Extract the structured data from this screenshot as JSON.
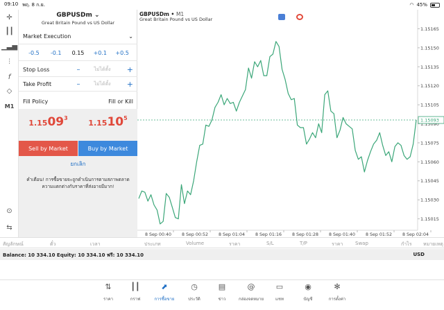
{
  "status": {
    "time": "09:10",
    "date": "พฤ. 8 ก.ย.",
    "battery": "45%"
  },
  "toolrail": {
    "indicator_label": "M1"
  },
  "panel": {
    "symbol": "GBPUSDm",
    "symbol_desc": "Great Britain Pound vs US Dollar",
    "execution": "Market Execution",
    "volume": {
      "minus05": "-0.5",
      "minus01": "-0.1",
      "value": "0.15",
      "plus01": "+0.1",
      "plus05": "+0.5"
    },
    "stop_loss": {
      "label": "Stop Loss",
      "placeholder": "ไม่ได้ตั้ง"
    },
    "take_profit": {
      "label": "Take Profit",
      "placeholder": "ไม่ได้ตั้ง"
    },
    "fill_policy": {
      "label": "Fill Policy",
      "value": "Fill or Kill"
    },
    "bid": {
      "prefix": "1.15",
      "big": "09",
      "sup": "3"
    },
    "ask": {
      "prefix": "1.15",
      "big": "10",
      "sup": "5"
    },
    "sell_label": "Sell by Market",
    "buy_label": "Buy by Market",
    "cancel_label": "ยกเลิก",
    "warning": "คำเตือน! การซื้อขายจะถูกดำเนินการตามสภาพตลาด ความแตกต่างกับราคาที่ส่งอาจมีมาก!"
  },
  "chart": {
    "symbol": "GBPUSDm",
    "timeframe": "M1",
    "subtitle": "Great Britain Pound vs US Dollar",
    "current_price_label": "1.15093",
    "line_color": "#3aa678"
  },
  "chart_data": {
    "type": "line",
    "x_ticks": [
      "8 Sep 00:40",
      "8 Sep 00:52",
      "8 Sep 01:04",
      "8 Sep 01:16",
      "8 Sep 01:28",
      "8 Sep 01:40",
      "8 Sep 01:52",
      "8 Sep 02:04"
    ],
    "y_ticks": [
      "1.15165",
      "1.15150",
      "1.15135",
      "1.15120",
      "1.15105",
      "1.15090",
      "1.15075",
      "1.15060",
      "1.15045",
      "1.15030",
      "1.15015"
    ],
    "ylim": [
      1.15006,
      1.15168
    ],
    "current_price": 1.15093,
    "values": [
      1.15031,
      1.15037,
      1.15036,
      1.15029,
      1.15034,
      1.15026,
      1.15022,
      1.15011,
      1.15013,
      1.15035,
      1.15032,
      1.15024,
      1.15016,
      1.15015,
      1.15042,
      1.15027,
      1.15037,
      1.15034,
      1.15045,
      1.1506,
      1.15073,
      1.15074,
      1.15089,
      1.15088,
      1.15093,
      1.15103,
      1.15107,
      1.15113,
      1.15105,
      1.1511,
      1.15106,
      1.15107,
      1.151,
      1.15107,
      1.15112,
      1.15117,
      1.15134,
      1.15126,
      1.15139,
      1.15135,
      1.1514,
      1.15128,
      1.15128,
      1.15143,
      1.15145,
      1.15155,
      1.15151,
      1.15133,
      1.15125,
      1.15114,
      1.15109,
      1.1511,
      1.15089,
      1.15087,
      1.15087,
      1.15074,
      1.15078,
      1.15083,
      1.15079,
      1.1509,
      1.15083,
      1.15113,
      1.15116,
      1.151,
      1.15098,
      1.15079,
      1.15085,
      1.15095,
      1.1509,
      1.15088,
      1.15086,
      1.15069,
      1.15062,
      1.15064,
      1.15052,
      1.15061,
      1.15068,
      1.15074,
      1.15077,
      1.15083,
      1.15073,
      1.15065,
      1.15068,
      1.1506,
      1.15072,
      1.15075,
      1.15073,
      1.15065,
      1.15062,
      1.15064,
      1.15074,
      1.15093
    ]
  },
  "columns": [
    "สัญลักษณ์",
    "ตั๋ว",
    "เวลา",
    "ประเภท",
    "Volume",
    "ราคา",
    "S/L",
    "T/P",
    "ราคา",
    "Swap",
    "กำไร",
    "หมายเหตุ"
  ],
  "balance": {
    "text": "Balance: 10 334.10 Equity: 10 334.10 ฟรี: 10 334.10",
    "currency": "USD"
  },
  "nav": [
    {
      "label": "ราคา",
      "icon": "arrows-updown-icon"
    },
    {
      "label": "กราฟ",
      "icon": "candles-icon"
    },
    {
      "label": "การซื้อขาย",
      "icon": "trade-chart-icon"
    },
    {
      "label": "ประวัติ",
      "icon": "history-icon"
    },
    {
      "label": "ข่าว",
      "icon": "news-icon"
    },
    {
      "label": "กล่องจดหมาย",
      "icon": "mail-icon"
    },
    {
      "label": "แชท",
      "icon": "chat-icon"
    },
    {
      "label": "บัญชี",
      "icon": "account-icon"
    },
    {
      "label": "การตั้งค่า",
      "icon": "settings-icon"
    }
  ]
}
